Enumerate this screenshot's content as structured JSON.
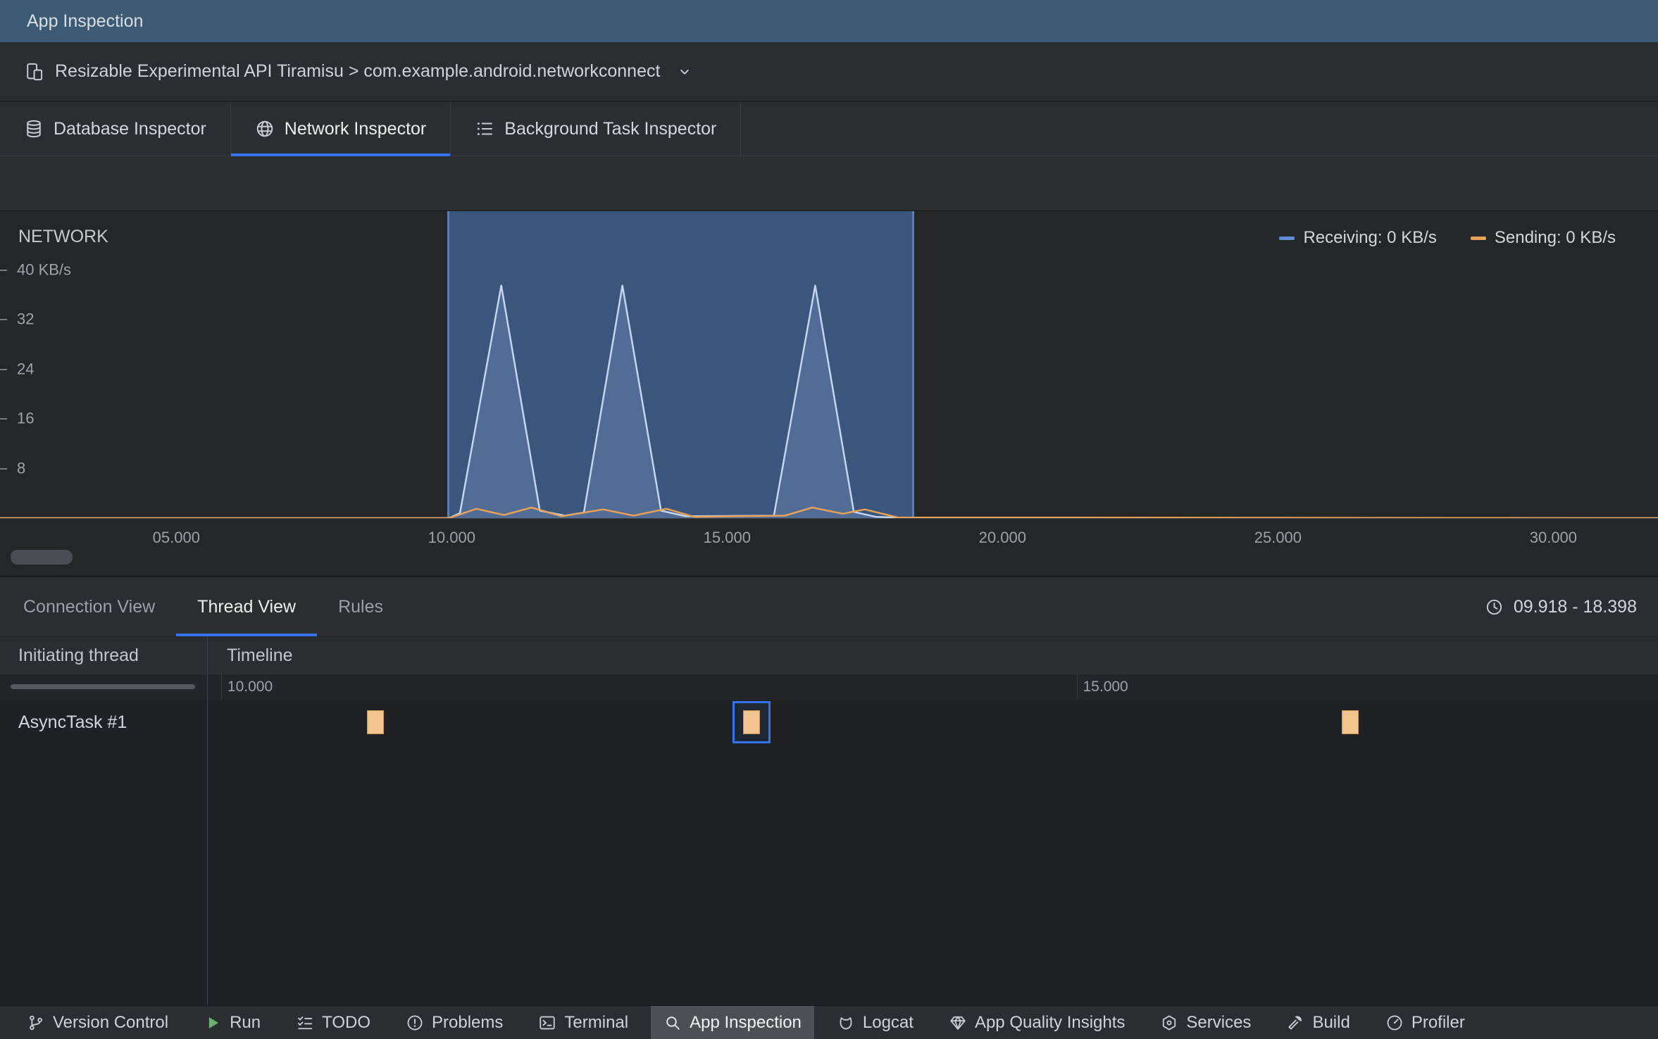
{
  "titlebar": {
    "title": "App Inspection"
  },
  "process_bar": {
    "label": "Resizable Experimental API Tiramisu > com.example.android.networkconnect"
  },
  "inspector_tabs": [
    {
      "label": "Database Inspector",
      "icon": "database-icon",
      "selected": false
    },
    {
      "label": "Network Inspector",
      "icon": "globe-icon",
      "selected": true
    },
    {
      "label": "Background Task Inspector",
      "icon": "task-list-icon",
      "selected": false
    }
  ],
  "chart_data": {
    "type": "area",
    "title": "NETWORK",
    "unit": "KB/s",
    "x_range": [
      1.8,
      31.9
    ],
    "y_range": [
      0,
      49.5
    ],
    "x_ticks": [
      {
        "t": 5,
        "label": "05.000"
      },
      {
        "t": 10,
        "label": "10.000"
      },
      {
        "t": 15,
        "label": "15.000"
      },
      {
        "t": 20,
        "label": "20.000"
      },
      {
        "t": 25,
        "label": "25.000"
      },
      {
        "t": 30,
        "label": "30.000"
      }
    ],
    "y_ticks": [
      {
        "v": 40,
        "label": "40 KB/s"
      },
      {
        "v": 32,
        "label": "32"
      },
      {
        "v": 24,
        "label": "24"
      },
      {
        "v": 16,
        "label": "16"
      },
      {
        "v": 8,
        "label": "8"
      }
    ],
    "selection": {
      "start": 9.918,
      "end": 18.398,
      "fill": "rgba(77,125,194,0.55)",
      "border": "#4E80C9"
    },
    "legend": [
      {
        "label": "Receiving: 0 KB/s",
        "color": "#5E8CD9"
      },
      {
        "label": "Sending: 0 KB/s",
        "color": "#E8A157"
      }
    ],
    "series": [
      {
        "name": "receiving",
        "stroke": "#C2D5F2",
        "area": "rgba(164,193,238,0.22)",
        "points": [
          [
            1.8,
            0
          ],
          [
            9.95,
            0
          ],
          [
            10.15,
            0.8
          ],
          [
            10.9,
            37.5
          ],
          [
            11.6,
            1.2
          ],
          [
            12.05,
            0.4
          ],
          [
            12.4,
            0.9
          ],
          [
            13.1,
            37.5
          ],
          [
            13.8,
            1.2
          ],
          [
            14.25,
            0.3
          ],
          [
            15.85,
            0.4
          ],
          [
            16.6,
            37.5
          ],
          [
            17.3,
            1.0
          ],
          [
            17.7,
            0.2
          ],
          [
            18.35,
            0
          ],
          [
            31.9,
            0
          ]
        ]
      },
      {
        "name": "sending",
        "stroke": "#E8A157",
        "area": null,
        "points": [
          [
            1.8,
            0
          ],
          [
            9.95,
            0
          ],
          [
            10.45,
            1.5
          ],
          [
            10.95,
            0.5
          ],
          [
            11.45,
            1.7
          ],
          [
            12.0,
            0.3
          ],
          [
            12.75,
            1.4
          ],
          [
            13.3,
            0.4
          ],
          [
            13.9,
            1.5
          ],
          [
            14.4,
            0.2
          ],
          [
            16.05,
            0.4
          ],
          [
            16.55,
            1.7
          ],
          [
            17.1,
            0.7
          ],
          [
            17.5,
            1.4
          ],
          [
            18.1,
            0.1
          ],
          [
            31.9,
            0
          ]
        ]
      }
    ]
  },
  "thread_view": {
    "tabs": [
      {
        "label": "Connection View",
        "selected": false
      },
      {
        "label": "Thread View",
        "selected": true
      },
      {
        "label": "Rules",
        "selected": false
      }
    ],
    "time_range_label": "09.918 - 18.398",
    "columns": [
      "Initiating thread",
      "Timeline"
    ],
    "range": [
      9.918,
      18.398
    ],
    "ruler_ticks": [
      {
        "t": 10,
        "label": "10.000"
      },
      {
        "t": 15,
        "label": "15.000"
      }
    ],
    "rows": [
      {
        "thread": "AsyncTask #1",
        "events": [
          {
            "t": 10.9,
            "selected": false
          },
          {
            "t": 13.1,
            "selected": true
          },
          {
            "t": 16.6,
            "selected": false
          }
        ]
      }
    ],
    "accent": "#3574F0",
    "event_color": "#F2C48E"
  },
  "bottom_bar": {
    "items": [
      {
        "label": "Version Control",
        "icon": "branch-icon",
        "selected": false
      },
      {
        "label": "Run",
        "icon": "run-icon",
        "selected": false
      },
      {
        "label": "TODO",
        "icon": "todo-icon",
        "selected": false
      },
      {
        "label": "Problems",
        "icon": "problems-icon",
        "selected": false
      },
      {
        "label": "Terminal",
        "icon": "terminal-icon",
        "selected": false
      },
      {
        "label": "App Inspection",
        "icon": "app-inspection-icon",
        "selected": true
      },
      {
        "label": "Logcat",
        "icon": "logcat-icon",
        "selected": false
      },
      {
        "label": "App Quality Insights",
        "icon": "insights-icon",
        "selected": false
      },
      {
        "label": "Services",
        "icon": "services-icon",
        "selected": false
      },
      {
        "label": "Build",
        "icon": "build-icon",
        "selected": false
      },
      {
        "label": "Profiler",
        "icon": "profiler-icon",
        "selected": false
      }
    ]
  }
}
